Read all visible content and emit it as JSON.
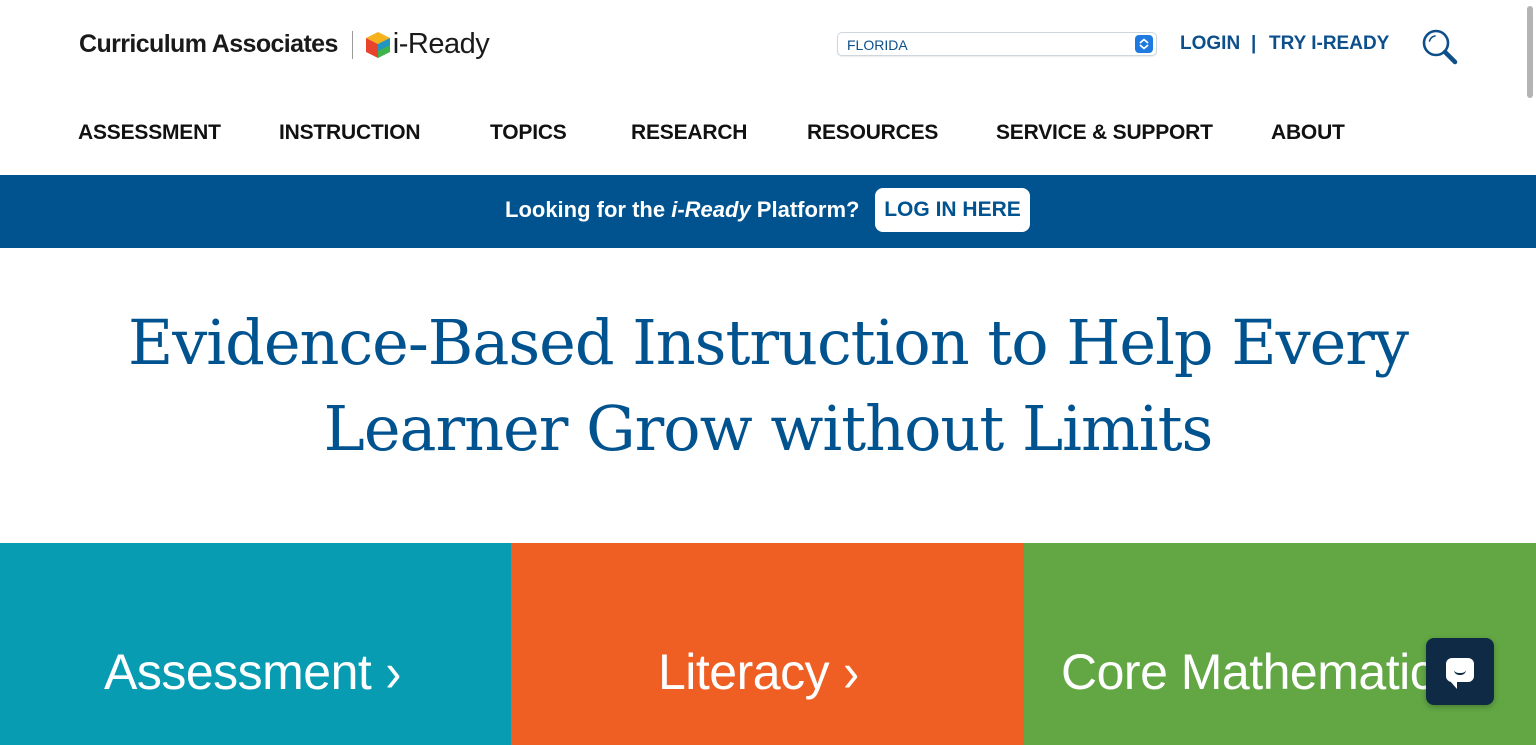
{
  "brand": {
    "company": "Curriculum Associates",
    "product": "i-Ready"
  },
  "state_selector": {
    "value": "FLORIDA"
  },
  "header_links": {
    "login": "LOGIN",
    "separator": "|",
    "try": "TRY I-READY"
  },
  "search": {
    "icon": "search-icon"
  },
  "nav": {
    "items": [
      {
        "label": "ASSESSMENT"
      },
      {
        "label": "INSTRUCTION"
      },
      {
        "label": "TOPICS"
      },
      {
        "label": "RESEARCH"
      },
      {
        "label": "RESOURCES"
      },
      {
        "label": "SERVICE & SUPPORT"
      },
      {
        "label": "ABOUT"
      }
    ]
  },
  "banner": {
    "text_before": "Looking for the ",
    "text_em": "i-Ready",
    "text_after": " Platform?",
    "button": "LOG IN HERE"
  },
  "hero": {
    "line1": "Evidence-Based Instruction to Help Every",
    "line2": "Learner Grow without Limits"
  },
  "tiles": [
    {
      "label": "Assessment",
      "chevron": "›"
    },
    {
      "label": "Literacy",
      "chevron": "›"
    },
    {
      "label": "Core Mathematics",
      "chevron": "›"
    }
  ],
  "chat": {
    "icon": "chat-icon"
  },
  "colors": {
    "brand_blue": "#00538f",
    "tile_assessment": "#089cb3",
    "tile_literacy": "#ef5f24",
    "tile_math": "#62a744",
    "chat_bg": "#0f2a44"
  }
}
